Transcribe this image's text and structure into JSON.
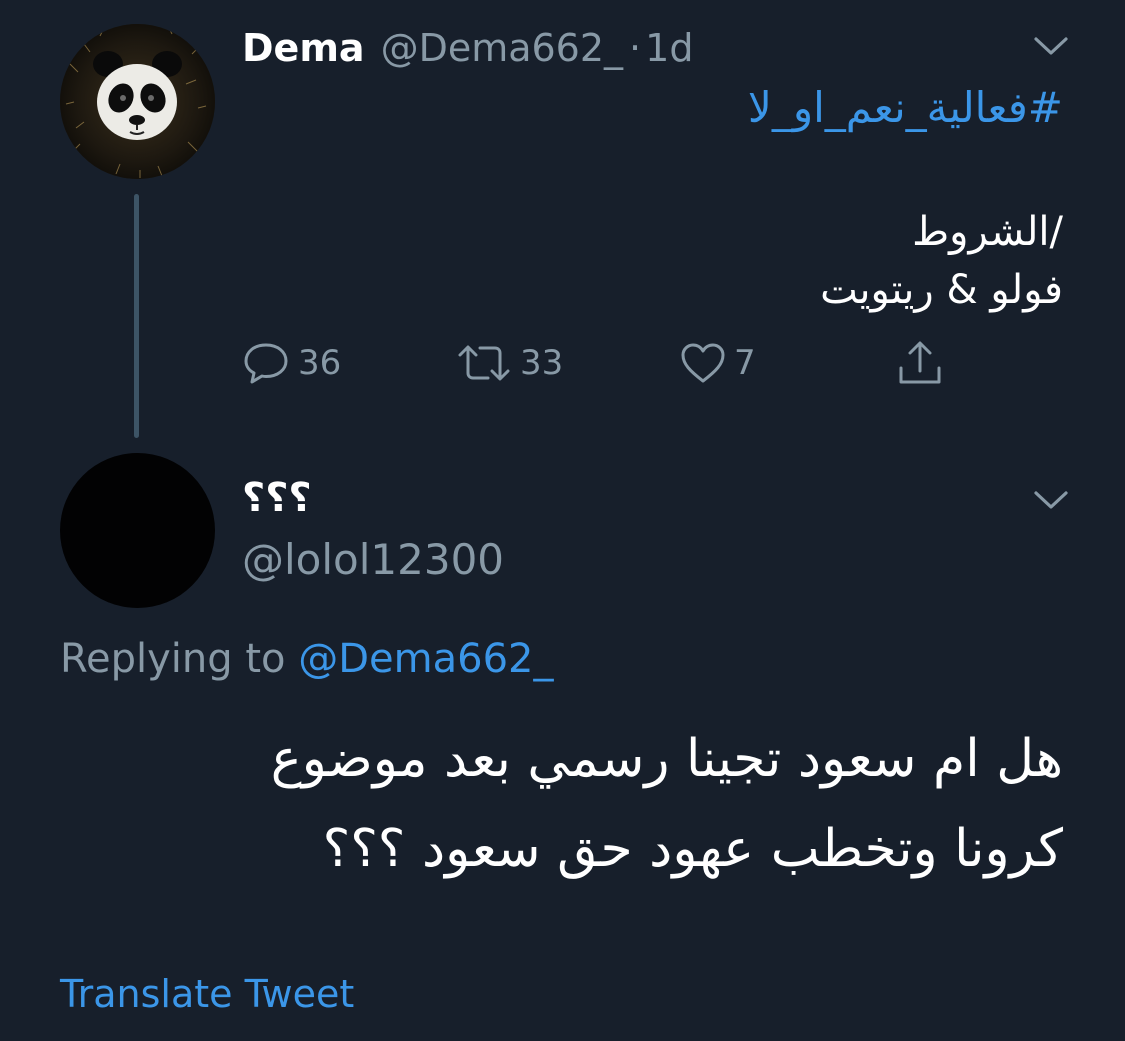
{
  "parent_tweet": {
    "display_name": "Dema",
    "handle": "@Dema662_",
    "separator": "·",
    "time": "1d",
    "hashtag": "#فعالية_نعم_او_لا",
    "body_lines": [
      "/الشروط",
      "فولو & ريتويت"
    ],
    "counts": {
      "replies": "36",
      "retweets": "33",
      "likes": "7"
    },
    "icons": [
      "reply-icon",
      "retweet-icon",
      "like-icon",
      "share-icon",
      "chevron-down-icon"
    ]
  },
  "reply_tweet": {
    "display_name": "؟؟؟",
    "handle": "@lolol12300",
    "replying_prefix": "Replying to",
    "replying_to": "@Dema662_",
    "body_lines": [
      "هل ام سعود تجينا رسمي بعد موضوع",
      "كرونا وتخطب عهود حق سعود ؟؟؟"
    ],
    "translate_label": "Translate Tweet"
  },
  "colors": {
    "background": "#171f2b",
    "primary_text": "#ffffff",
    "secondary_text": "#8899a6",
    "link": "#3b96e8",
    "thread_line": "#3d5466"
  }
}
